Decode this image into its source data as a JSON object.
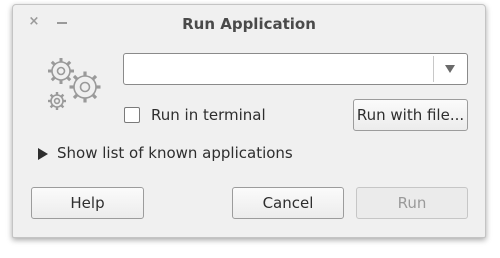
{
  "window": {
    "title": "Run Application",
    "close_glyph": "×"
  },
  "command": {
    "value": "",
    "placeholder": ""
  },
  "run_in_terminal": {
    "label": "Run in terminal",
    "checked": false
  },
  "buttons": {
    "run_with_file": "Run with file...",
    "help": "Help",
    "cancel": "Cancel",
    "run": "Run"
  },
  "expander": {
    "label": "Show list of known applications",
    "expanded": false
  },
  "icons": {
    "app_icon": "gears-icon",
    "dropdown": "chevron-down-icon",
    "expander": "triangle-right-icon"
  },
  "colors": {
    "window_bg": "#f0f0f0",
    "title_text": "#4a4a4a",
    "disabled_text": "#9a9a9a"
  }
}
